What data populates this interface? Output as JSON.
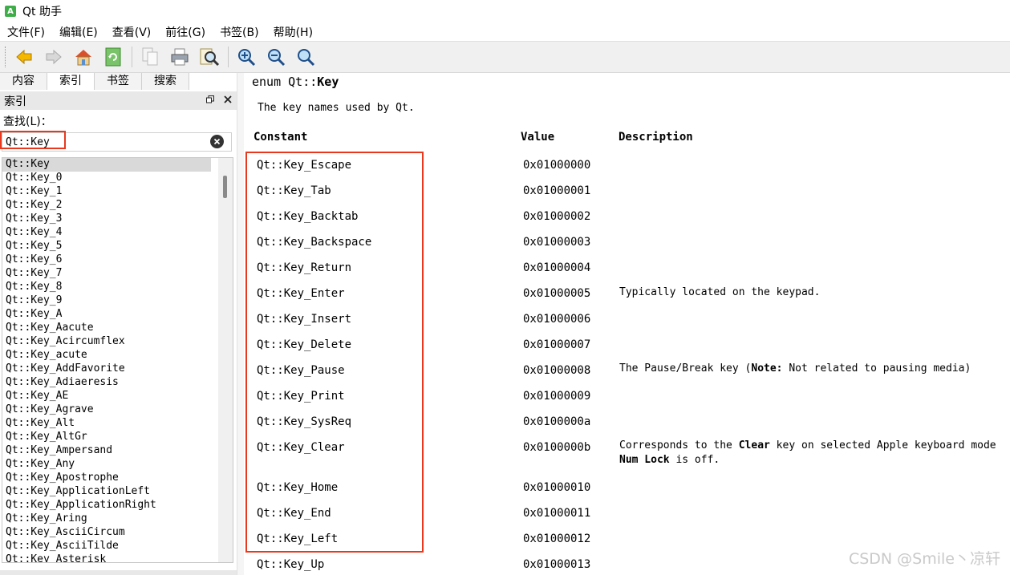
{
  "window": {
    "title": "Qt 助手",
    "icon_letter": "A"
  },
  "menu": [
    "文件(F)",
    "编辑(E)",
    "查看(V)",
    "前往(G)",
    "书签(B)",
    "帮助(H)"
  ],
  "toolbar_icons": [
    "back-arrow-icon",
    "forward-arrow-icon",
    "home-icon",
    "sync-icon",
    "copy-icon",
    "print-icon",
    "find-icon",
    "zoom-in-icon",
    "zoom-out-icon",
    "zoom-reset-icon"
  ],
  "sidebar": {
    "tabs": [
      "内容",
      "索引",
      "书签",
      "搜索"
    ],
    "active_tab": "索引",
    "panel_title": "索引",
    "find_label": "查找(L)：",
    "search_value": "Qt::Key",
    "index_items": [
      "Qt::Key",
      "Qt::Key_0",
      "Qt::Key_1",
      "Qt::Key_2",
      "Qt::Key_3",
      "Qt::Key_4",
      "Qt::Key_5",
      "Qt::Key_6",
      "Qt::Key_7",
      "Qt::Key_8",
      "Qt::Key_9",
      "Qt::Key_A",
      "Qt::Key_Aacute",
      "Qt::Key_Acircumflex",
      "Qt::Key_acute",
      "Qt::Key_AddFavorite",
      "Qt::Key_Adiaeresis",
      "Qt::Key_AE",
      "Qt::Key_Agrave",
      "Qt::Key_Alt",
      "Qt::Key_AltGr",
      "Qt::Key_Ampersand",
      "Qt::Key_Any",
      "Qt::Key_Apostrophe",
      "Qt::Key_ApplicationLeft",
      "Qt::Key_ApplicationRight",
      "Qt::Key_Aring",
      "Qt::Key_AsciiCircum",
      "Qt::Key_AsciiTilde",
      "Qt::Key_Asterisk"
    ]
  },
  "doc": {
    "enum_prefix": "enum Qt::",
    "enum_name": "Key",
    "intro": "The key names used by Qt.",
    "headers": {
      "constant": "Constant",
      "value": "Value",
      "description": "Description"
    },
    "rows": [
      {
        "constant": "Qt::Key_Escape",
        "value": "0x01000000",
        "desc": ""
      },
      {
        "constant": "Qt::Key_Tab",
        "value": "0x01000001",
        "desc": ""
      },
      {
        "constant": "Qt::Key_Backtab",
        "value": "0x01000002",
        "desc": ""
      },
      {
        "constant": "Qt::Key_Backspace",
        "value": "0x01000003",
        "desc": ""
      },
      {
        "constant": "Qt::Key_Return",
        "value": "0x01000004",
        "desc": ""
      },
      {
        "constant": "Qt::Key_Enter",
        "value": "0x01000005",
        "desc": "Typically located on the keypad."
      },
      {
        "constant": "Qt::Key_Insert",
        "value": "0x01000006",
        "desc": ""
      },
      {
        "constant": "Qt::Key_Delete",
        "value": "0x01000007",
        "desc": ""
      },
      {
        "constant": "Qt::Key_Pause",
        "value": "0x01000008",
        "desc": ""
      },
      {
        "constant": "Qt::Key_Print",
        "value": "0x01000009",
        "desc": ""
      },
      {
        "constant": "Qt::Key_SysReq",
        "value": "0x0100000a",
        "desc": ""
      },
      {
        "constant": "Qt::Key_Clear",
        "value": "0x0100000b",
        "desc": ""
      },
      {
        "constant": "Qt::Key_Home",
        "value": "0x01000010",
        "desc": ""
      },
      {
        "constant": "Qt::Key_End",
        "value": "0x01000011",
        "desc": ""
      },
      {
        "constant": "Qt::Key_Left",
        "value": "0x01000012",
        "desc": ""
      },
      {
        "constant": "Qt::Key_Up",
        "value": "0x01000013",
        "desc": ""
      }
    ],
    "pause_desc": {
      "pre": "The Pause/Break key (",
      "note": "Note:",
      "post": " Not related to pausing media)"
    },
    "clear_desc": {
      "l1_pre": "Corresponds to the ",
      "l1_bold": "Clear",
      "l1_post": " key on selected Apple keyboard mode",
      "l2_bold": "Num Lock",
      "l2_post": " is off."
    }
  },
  "watermark": "CSDN @Smile丶凉轩",
  "colors": {
    "highlight_border": "#e8391f",
    "toolbar_bg": "#f0f0f0"
  }
}
